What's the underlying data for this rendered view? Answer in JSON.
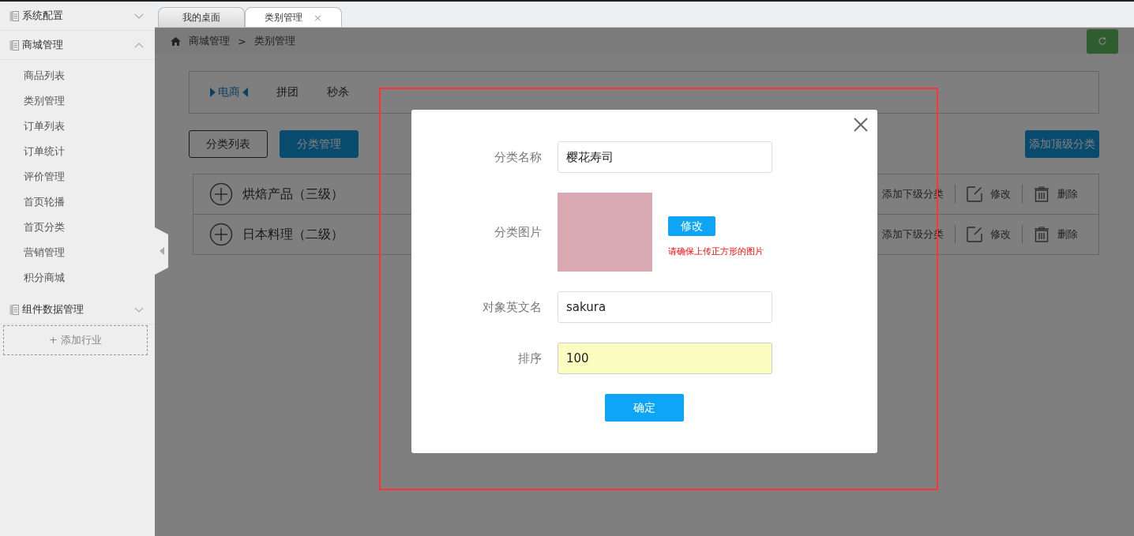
{
  "sidebar": {
    "groups": [
      {
        "label": "系统配置",
        "expanded": false
      },
      {
        "label": "商城管理",
        "expanded": true,
        "items": [
          "商品列表",
          "类别管理",
          "订单列表",
          "订单统计",
          "评价管理",
          "首页轮播",
          "首页分类",
          "营销管理",
          "积分商城"
        ]
      },
      {
        "label": "组件数据管理",
        "expanded": false
      }
    ],
    "add_button": "+ 添加行业"
  },
  "tabs": [
    {
      "label": "我的桌面",
      "selected": false
    },
    {
      "label": "类别管理",
      "selected": true,
      "close": "×"
    }
  ],
  "breadcrumb": {
    "items": [
      "商城管理",
      "类别管理"
    ],
    "separator": ">"
  },
  "industry_tabs": [
    {
      "label": "电商",
      "selected": true
    },
    {
      "label": "拼团",
      "selected": false
    },
    {
      "label": "秒杀",
      "selected": false
    }
  ],
  "view_buttons": [
    {
      "label": "分类列表",
      "selected": false
    },
    {
      "label": "分类管理",
      "selected": true
    }
  ],
  "add_top_button": "添加顶级分类",
  "categories": [
    {
      "name": "烘焙产品（三级）",
      "add_child": "添加下级分类",
      "edit": "修改",
      "delete": "删除"
    },
    {
      "name": "日本料理（二级）",
      "add_child": "添加下级分类",
      "edit": "修改",
      "delete": "删除"
    }
  ],
  "modal": {
    "fields": [
      {
        "kind": "text",
        "label": "分类名称",
        "value": "樱花寿司",
        "focused": false
      },
      {
        "kind": "image",
        "label": "分类图片",
        "button": "修改",
        "hint": "请确保上传正方形的图片"
      },
      {
        "kind": "text",
        "label": "对象英文名",
        "value": "sakura",
        "focused": false
      },
      {
        "kind": "text",
        "label": "排序",
        "value": "100",
        "focused": true
      }
    ],
    "submit": "确定"
  }
}
